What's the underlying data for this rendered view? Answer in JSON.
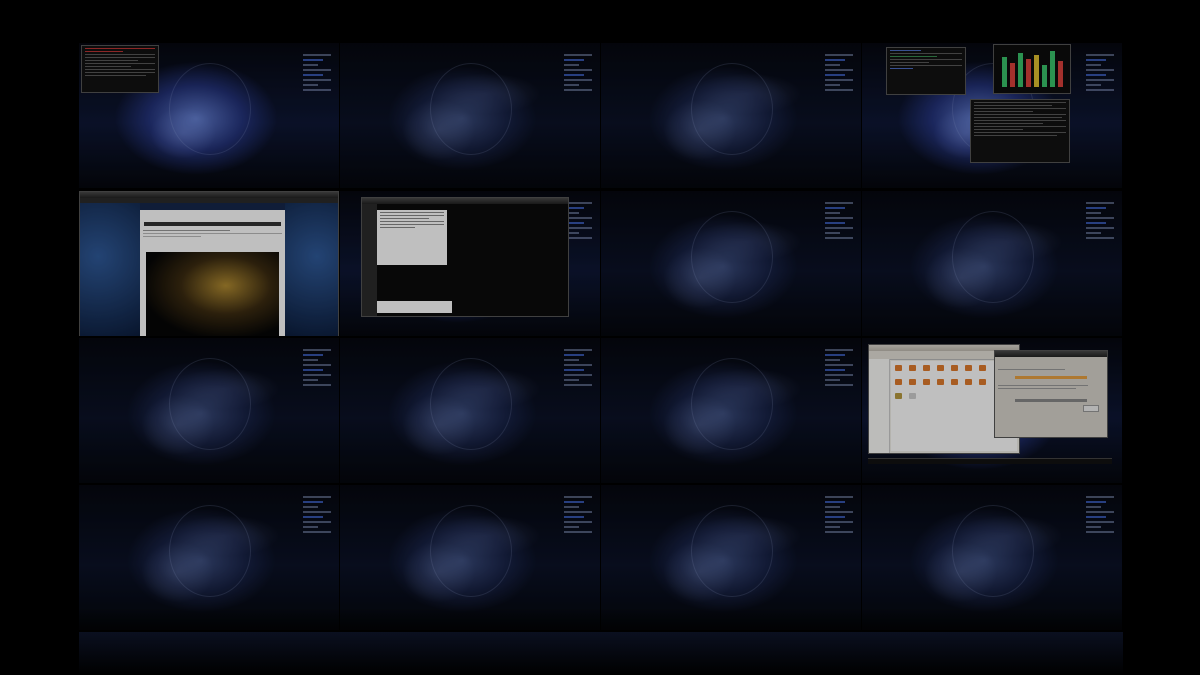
{
  "workspace_switcher": {
    "rows": 4,
    "columns": 4,
    "active_workspace": 8,
    "wallpaper_theme": "blue-abstract",
    "accent_color": "#4a6fe0"
  },
  "workspaces": [
    {
      "id": 1,
      "windows": [
        "terminal-red"
      ]
    },
    {
      "id": 2,
      "windows": []
    },
    {
      "id": 3,
      "windows": []
    },
    {
      "id": 4,
      "windows": [
        "terminal-small",
        "audio-mixer",
        "terminal-large"
      ]
    },
    {
      "id": 5,
      "windows": [
        "web-browser"
      ]
    },
    {
      "id": 6,
      "windows": [
        "image-viewer"
      ]
    },
    {
      "id": 7,
      "windows": []
    },
    {
      "id": 8,
      "windows": []
    },
    {
      "id": 9,
      "windows": []
    },
    {
      "id": 10,
      "windows": []
    },
    {
      "id": 11,
      "windows": []
    },
    {
      "id": 12,
      "windows": [
        "file-manager",
        "dialog"
      ]
    },
    {
      "id": 13,
      "windows": []
    },
    {
      "id": 14,
      "windows": []
    },
    {
      "id": 15,
      "windows": []
    },
    {
      "id": 16,
      "windows": []
    }
  ],
  "colors": {
    "terminal_alert": "#e63c3c",
    "mixer_green": "#39c36b",
    "mixer_red": "#d9403a",
    "mixer_yellow": "#e0c030",
    "folder_orange": "#e07a2c",
    "ocean_blue": "#16264a"
  }
}
